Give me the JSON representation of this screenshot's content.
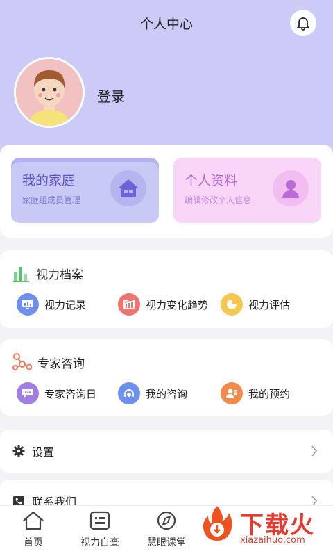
{
  "header": {
    "title": "个人中心"
  },
  "profile": {
    "login_label": "登录"
  },
  "quick_cards": {
    "family": {
      "title": "我的家庭",
      "subtitle": "家庭组成员管理"
    },
    "info": {
      "title": "个人资料",
      "subtitle": "编辑修改个人信息"
    }
  },
  "vision_section": {
    "title": "视力档案",
    "items": [
      {
        "label": "视力记录",
        "icon": "bar-chart-icon"
      },
      {
        "label": "视力变化趋势",
        "icon": "trend-icon"
      },
      {
        "label": "视力评估",
        "icon": "pie-chart-icon"
      }
    ]
  },
  "expert_section": {
    "title": "专家咨询",
    "items": [
      {
        "label": "专家咨询日",
        "icon": "chat-icon"
      },
      {
        "label": "我的咨询",
        "icon": "headset-icon"
      },
      {
        "label": "我的预约",
        "icon": "appointment-icon"
      }
    ]
  },
  "menu": {
    "settings": "设置",
    "contact": "联系我们"
  },
  "tabs": [
    {
      "label": "首页",
      "icon": "home-icon"
    },
    {
      "label": "视力自查",
      "icon": "eye-chart-icon"
    },
    {
      "label": "慧眼课堂",
      "icon": "compass-icon"
    }
  ],
  "watermark": {
    "text": "下载火",
    "url": "xiazaihuo.com"
  },
  "colors": {
    "header_bg": "#cccbf7",
    "family_card": "#c9c9f5",
    "info_card": "#f9d6f7",
    "accent_purple": "#6c63d9",
    "accent_pink": "#b86bd6",
    "watermark_red": "#e63b2e"
  }
}
